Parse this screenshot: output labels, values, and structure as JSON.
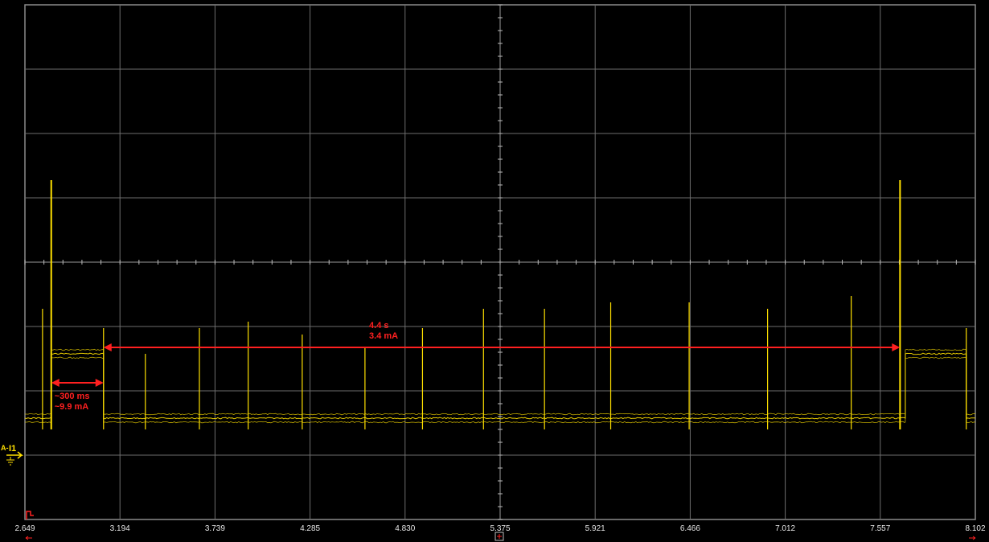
{
  "chart_data": {
    "type": "line",
    "channel": {
      "prefix": "A-",
      "name": "I1"
    },
    "x_ticks": [
      "2.649",
      "3.194",
      "3.739",
      "4.285",
      "4.830",
      "5.375",
      "5.921",
      "6.466",
      "7.012",
      "7.557",
      "8.102"
    ],
    "xlim": [
      2.649,
      8.102
    ],
    "divisions": {
      "x": 10,
      "y": 8
    },
    "grid": true,
    "series": [
      {
        "color": "#ffe000",
        "baseline": 0,
        "segments": [
          {
            "x_start": 2.649,
            "x_end": 2.8,
            "level": 0
          },
          {
            "x_start": 2.8,
            "x_end": 3.1,
            "level": 1.0
          },
          {
            "x_start": 3.1,
            "x_end": 7.7,
            "level": 0
          },
          {
            "x_start": 7.7,
            "x_end": 8.05,
            "level": 1.0
          },
          {
            "x_start": 8.05,
            "x_end": 8.102,
            "level": 0
          }
        ],
        "spikes": [
          {
            "x": 2.75,
            "peak": 1.7
          },
          {
            "x": 2.8,
            "peak": 3.7
          },
          {
            "x": 3.1,
            "peak": 1.4
          },
          {
            "x": 3.34,
            "peak": 1.0
          },
          {
            "x": 3.65,
            "peak": 1.4
          },
          {
            "x": 3.93,
            "peak": 1.5
          },
          {
            "x": 4.24,
            "peak": 1.3
          },
          {
            "x": 4.6,
            "peak": 1.1
          },
          {
            "x": 4.93,
            "peak": 1.4
          },
          {
            "x": 5.28,
            "peak": 1.7
          },
          {
            "x": 5.63,
            "peak": 1.7
          },
          {
            "x": 6.01,
            "peak": 1.8
          },
          {
            "x": 6.46,
            "peak": 1.8
          },
          {
            "x": 6.91,
            "peak": 1.7
          },
          {
            "x": 7.39,
            "peak": 1.9
          },
          {
            "x": 7.67,
            "peak": 3.7
          },
          {
            "x": 8.05,
            "peak": 1.4
          }
        ]
      }
    ],
    "annotations": [
      {
        "lines": [
          "~300 ms",
          "~9.9 mA"
        ],
        "x_from": 2.8,
        "x_to": 3.1,
        "arrow_y": 0.55,
        "color": "#ff2020"
      },
      {
        "lines": [
          "4.4 s",
          "3.4 mA"
        ],
        "x_from": 3.1,
        "x_to": 7.67,
        "arrow_y": 1.1,
        "color": "#ff2020"
      }
    ]
  }
}
